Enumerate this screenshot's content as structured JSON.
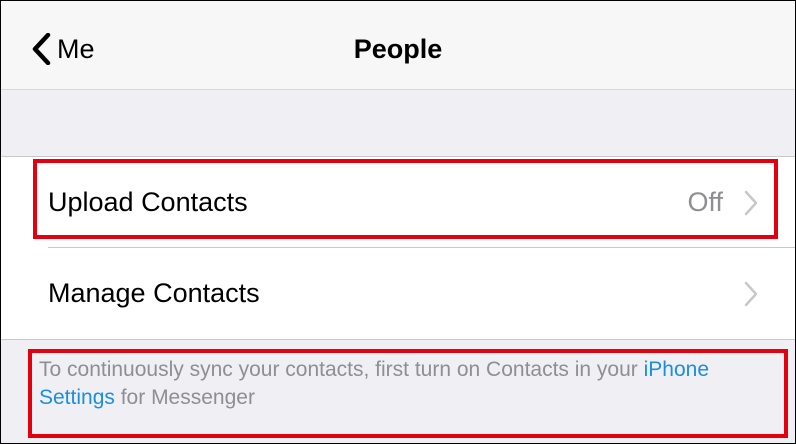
{
  "navbar": {
    "back_label": "Me",
    "title": "People"
  },
  "rows": [
    {
      "label": "Upload Contacts",
      "value": "Off"
    },
    {
      "label": "Manage Contacts",
      "value": ""
    }
  ],
  "footer": {
    "text_before": "To continuously sync your contacts, first turn on Contacts in your ",
    "link_text": "iPhone Settings",
    "text_after": " for Messenger"
  },
  "colors": {
    "highlight": "#e3000f",
    "link": "#1a8fe0",
    "secondary_text": "#8e8e93",
    "background": "#efeff4"
  },
  "icons": {
    "back": "chevron-left-icon",
    "row_disclosure": "chevron-right-icon"
  }
}
